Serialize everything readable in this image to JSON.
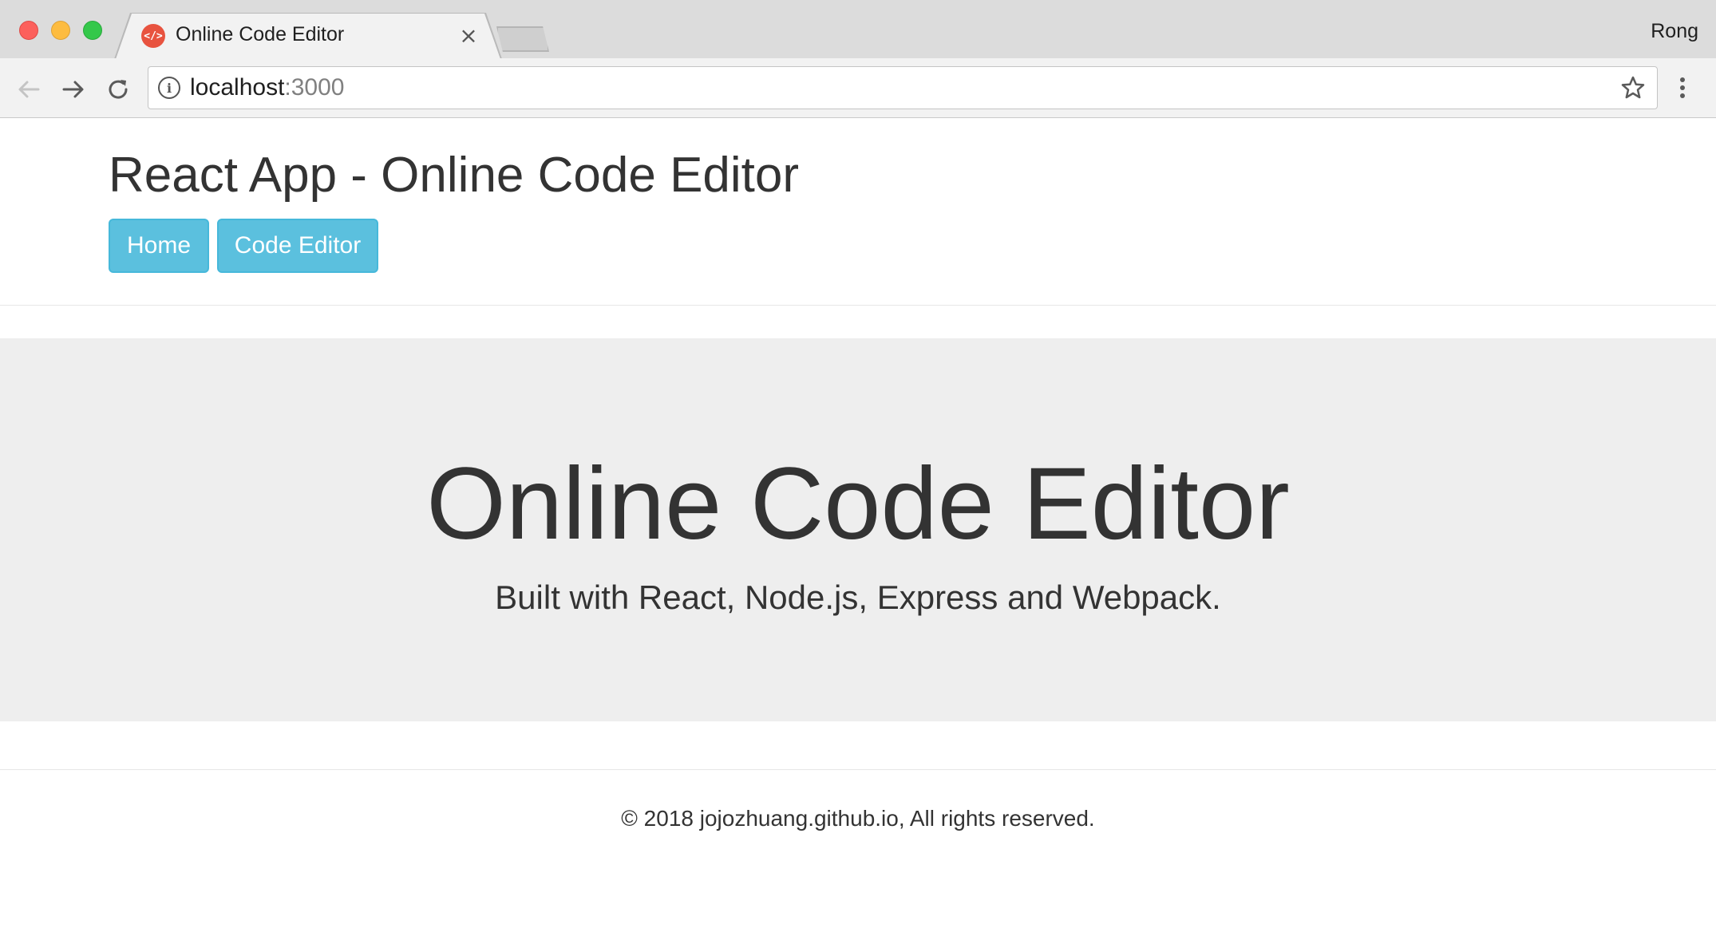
{
  "browser": {
    "tab_title": "Online Code Editor",
    "tab_close": "×",
    "profile_name": "Rong",
    "url_host": "localhost",
    "url_port": ":3000",
    "favicon_text": "</>"
  },
  "header": {
    "title": "React App - Online Code Editor",
    "nav": [
      {
        "label": "Home"
      },
      {
        "label": "Code Editor"
      }
    ]
  },
  "jumbotron": {
    "title": "Online Code Editor",
    "subtitle": "Built with React, Node.js, Express and Webpack."
  },
  "footer": {
    "text": "© 2018 jojozhuang.github.io, All rights reserved."
  },
  "colors": {
    "button_bg": "#5bc0de",
    "jumbotron_bg": "#eeeeee",
    "text": "#333333"
  }
}
